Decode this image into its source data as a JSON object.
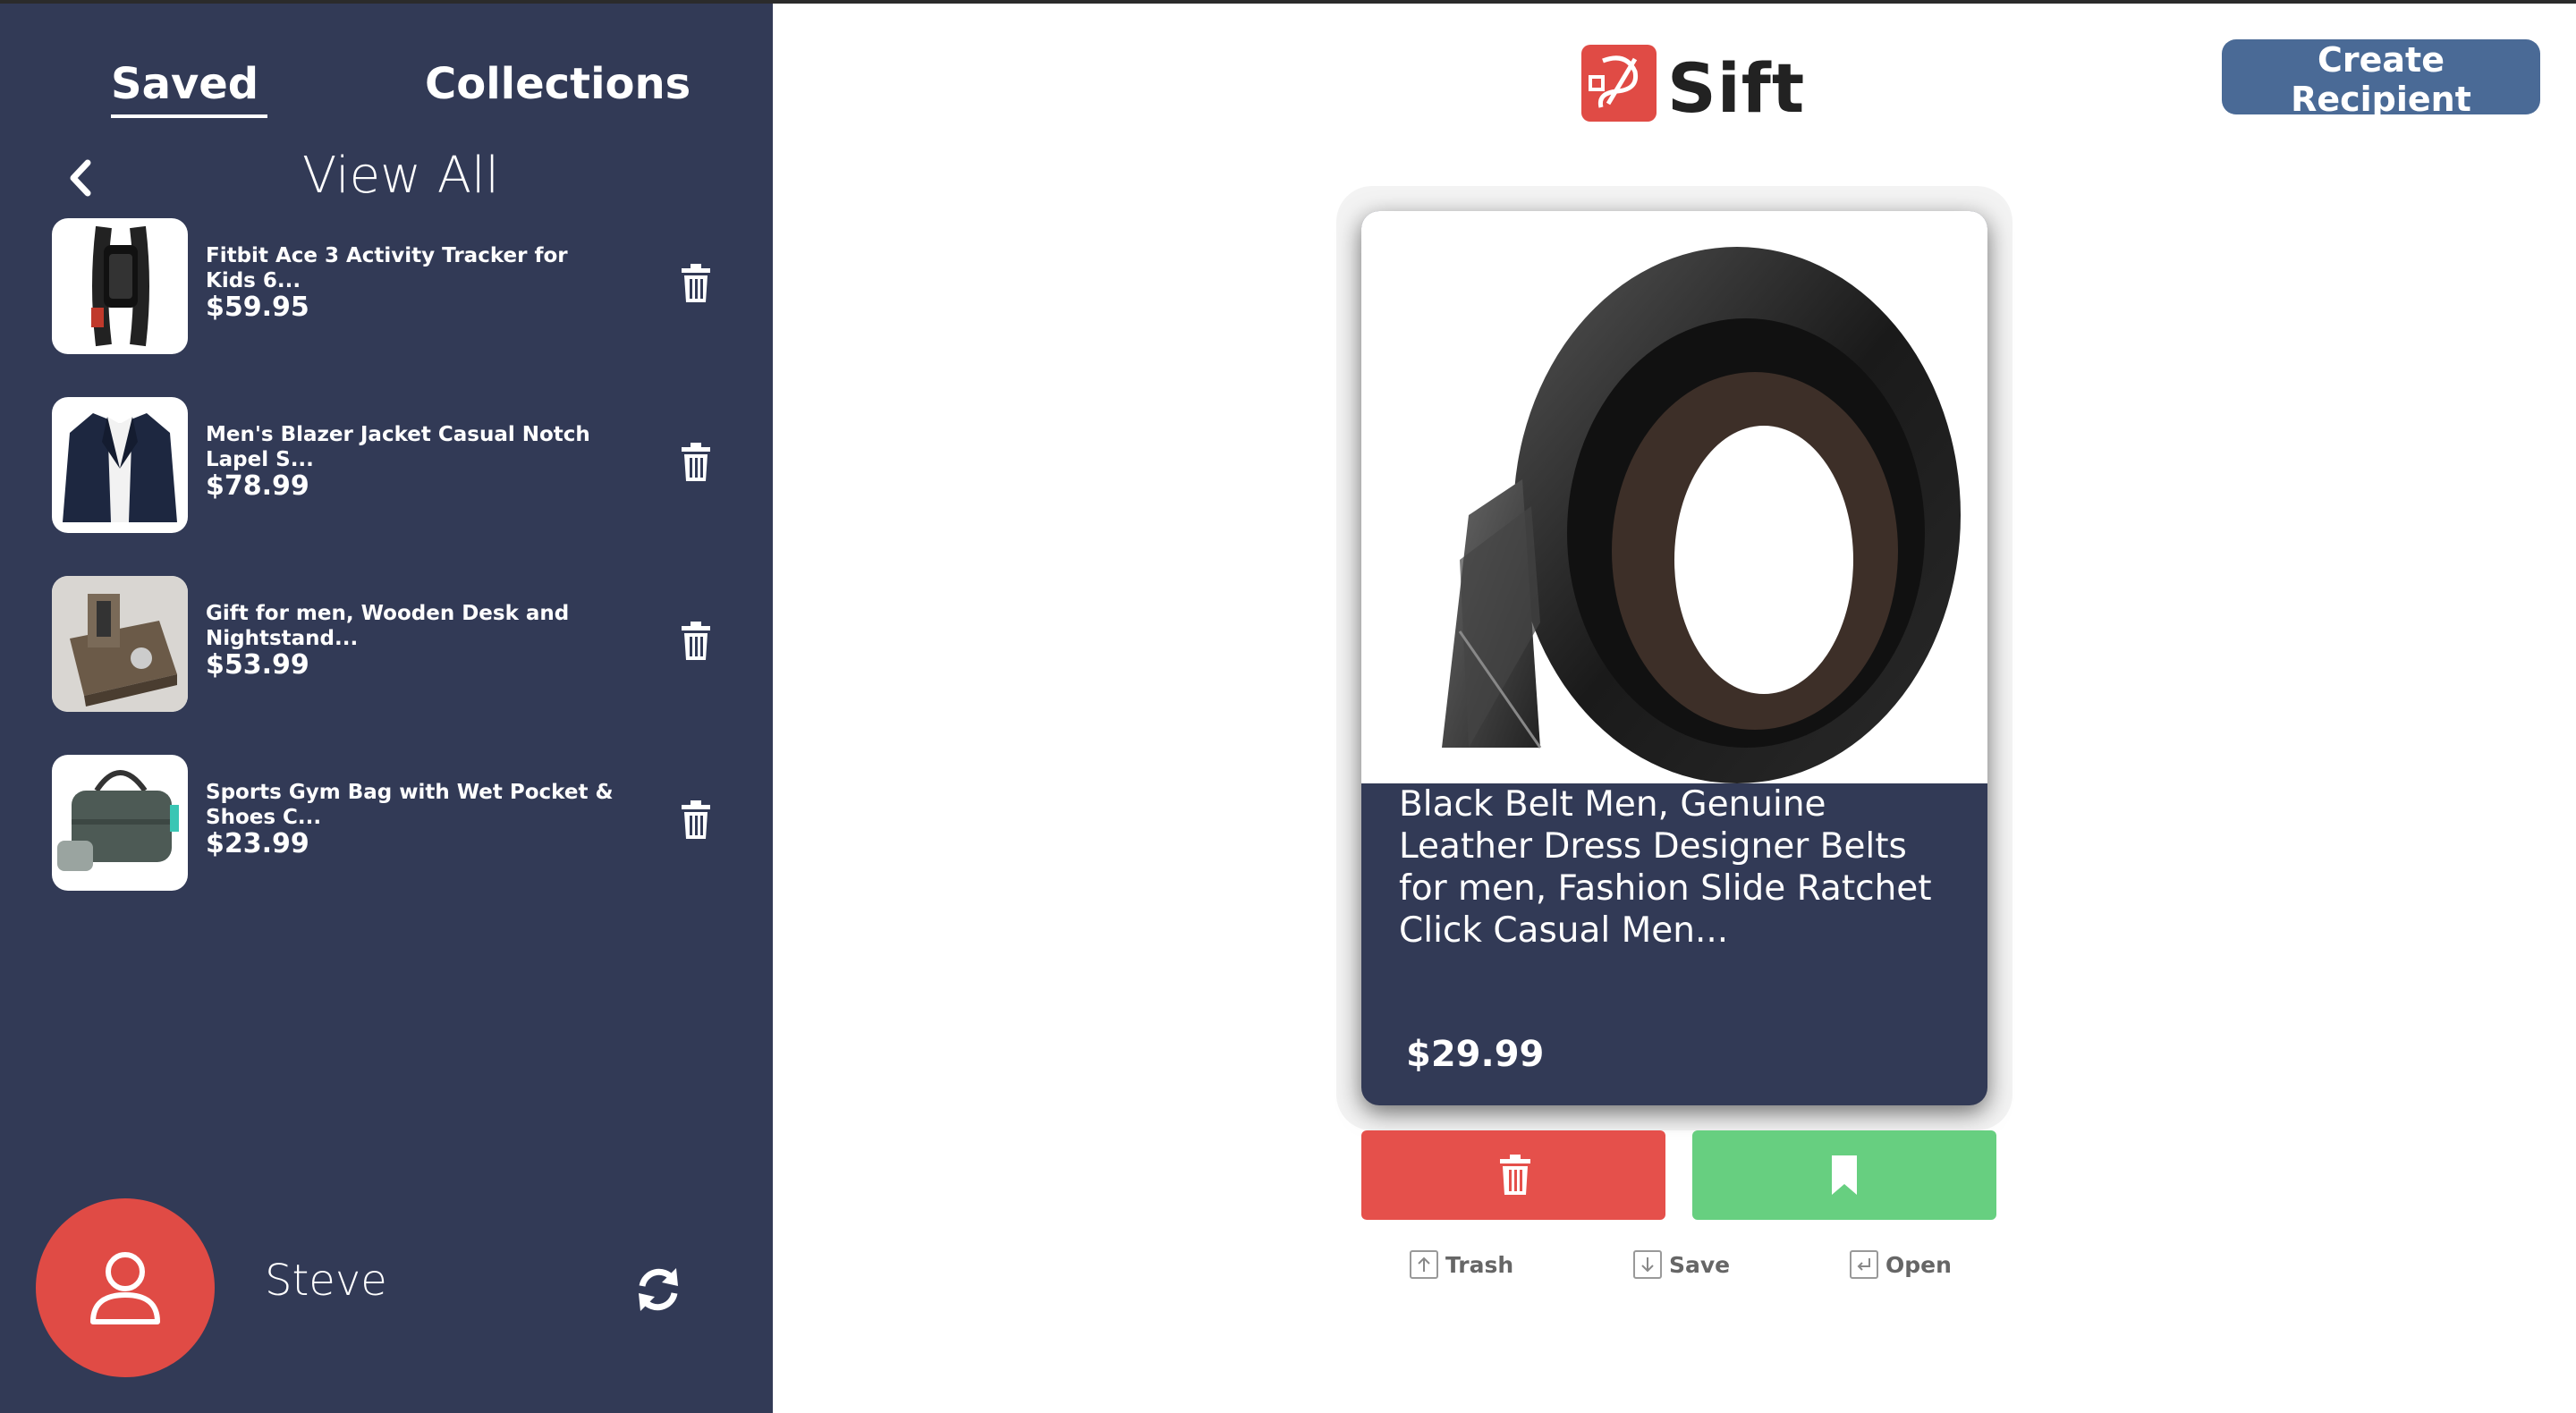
{
  "sidebar": {
    "tabs": [
      {
        "label": "Saved",
        "active": true
      },
      {
        "label": "Collections",
        "active": false
      }
    ],
    "header": "View All",
    "items": [
      {
        "name": "Fitbit Ace 3 Activity Tracker for Kids 6...",
        "price": "$59.95",
        "image": "fitness-tracker"
      },
      {
        "name": "Men's Blazer Jacket Casual Notch Lapel S...",
        "price": "$78.99",
        "image": "blazer-jacket"
      },
      {
        "name": "Gift for men, Wooden Desk and Nightstand...",
        "price": "$53.99",
        "image": "desk-organizer"
      },
      {
        "name": "Sports Gym Bag with Wet Pocket & Shoes C...",
        "price": "$23.99",
        "image": "gym-bag"
      }
    ],
    "user": {
      "name": "Steve"
    }
  },
  "header": {
    "logo_text": "Sift",
    "create_button": "Create Recipient"
  },
  "card": {
    "title": "Black Belt Men, Genuine Leather Dress Designer Belts for men, Fashion Slide Ratchet Click Casual Men...",
    "price": "$29.99",
    "image": "black-leather-belt"
  },
  "actions": {
    "hints": [
      {
        "key": "up-arrow",
        "label": "Trash"
      },
      {
        "key": "down-arrow",
        "label": "Save"
      },
      {
        "key": "return",
        "label": "Open"
      }
    ]
  },
  "colors": {
    "sidebar_bg": "#323a56",
    "accent_blue": "#4a6a96",
    "trash_red": "#e5504b",
    "save_green": "#67cf80",
    "avatar_red": "#e04b45"
  }
}
